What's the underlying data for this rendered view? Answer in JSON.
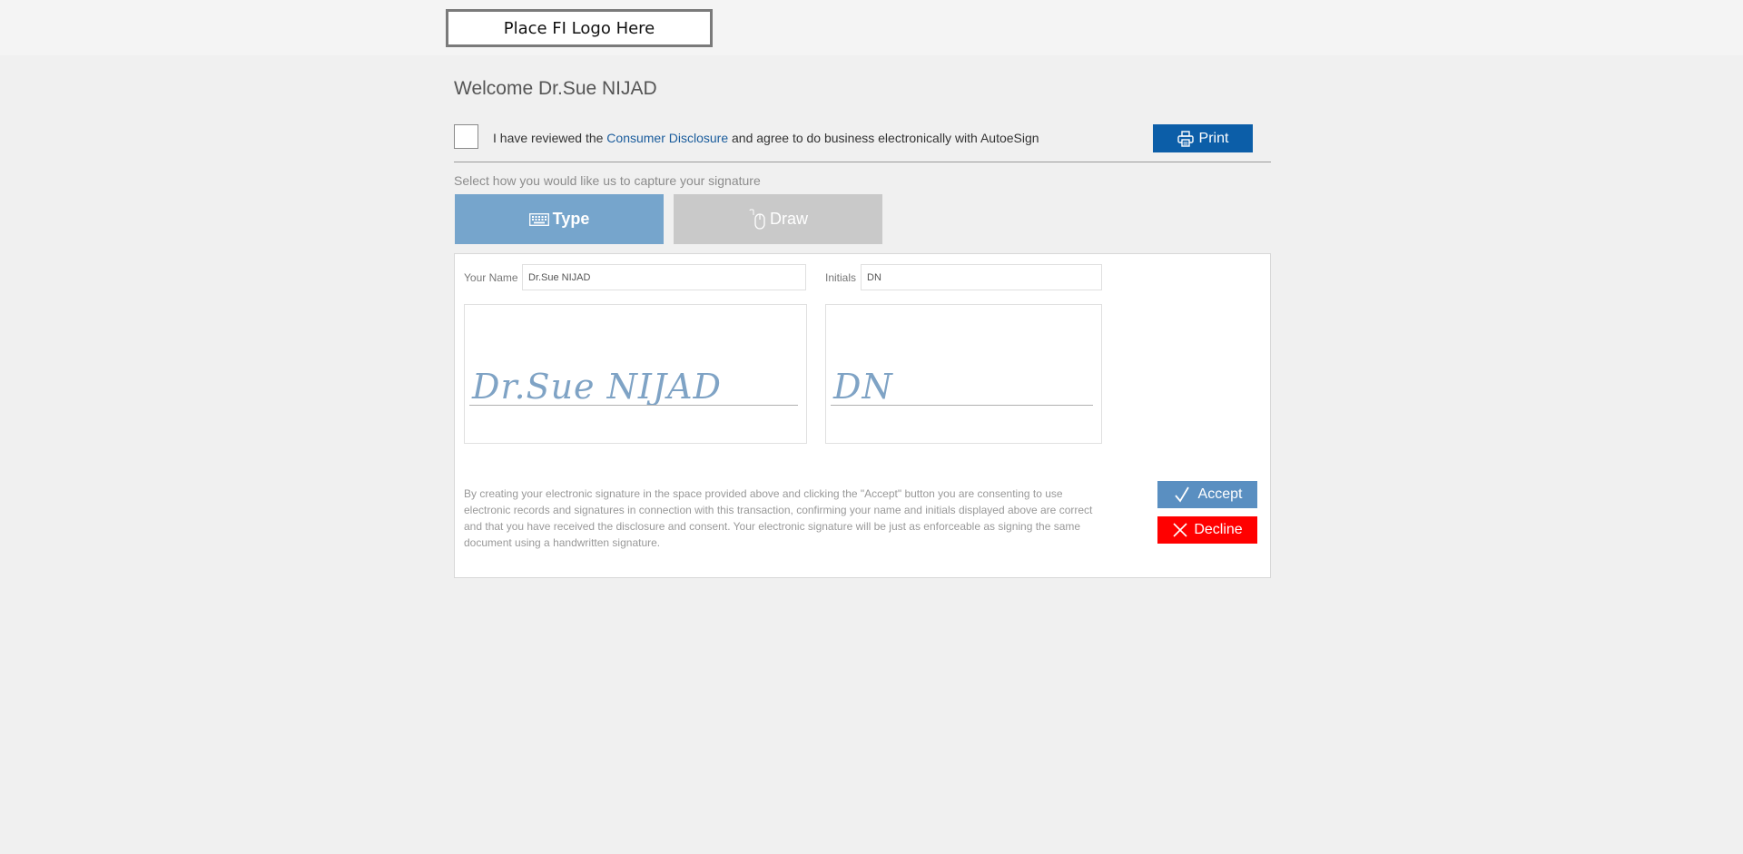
{
  "header": {
    "logo_placeholder": "Place FI Logo Here"
  },
  "welcome": "Welcome Dr.Sue NIJAD",
  "agreement": {
    "checked": false,
    "text_before": "I have reviewed the ",
    "link_text": "Consumer Disclosure",
    "text_after": " and agree to do business electronically with AutoeSign"
  },
  "print_button": {
    "label": "Print",
    "icon": "printer-icon"
  },
  "capture": {
    "label": "Select how you would like us to capture your signature",
    "tabs": [
      {
        "label": "Type",
        "icon": "keyboard-icon",
        "active": true
      },
      {
        "label": "Draw",
        "icon": "mouse-icon",
        "active": false
      }
    ]
  },
  "form": {
    "name_label": "Your Name",
    "name_value": "Dr.Sue NIJAD",
    "initials_label": "Initials",
    "initials_value": "DN"
  },
  "signature_preview": {
    "name": "Dr.Sue NIJAD",
    "initials": "DN"
  },
  "disclaimer": "By creating your electronic signature in the space provided above and clicking the \"Accept\" button you are consenting to use electronic records and signatures in connection with this transaction, confirming your name and initials displayed above are correct and that you have received the disclosure and consent. Your electronic signature will be just as enforceable as signing the same document using a handwritten signature.",
  "actions": {
    "accept_label": "Accept",
    "accept_icon": "checkmark-icon",
    "decline_label": "Decline",
    "decline_icon": "close-icon"
  },
  "colors": {
    "print": "#0c5ea8",
    "type_tab": "#76a5cc",
    "draw_tab": "#c9c9c9",
    "accept": "#5a8fc1",
    "decline": "#ff0000",
    "link": "#1a5c9c"
  }
}
